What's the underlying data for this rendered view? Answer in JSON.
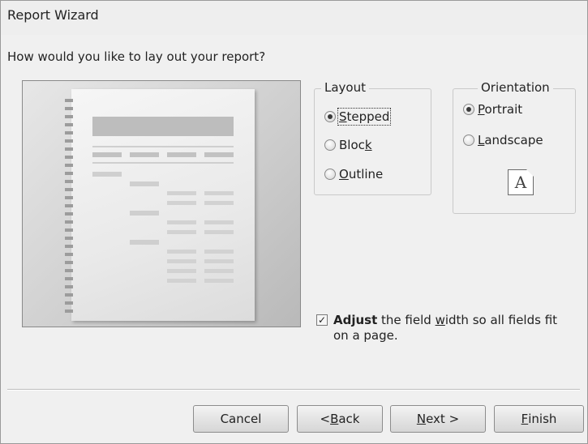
{
  "window": {
    "title": "Report Wizard"
  },
  "question": "How would you like to lay out your report?",
  "layout": {
    "label": "Layout",
    "options": [
      {
        "pre": "",
        "key": "S",
        "post": "tepped",
        "checked": true
      },
      {
        "pre": "Bloc",
        "key": "k",
        "post": "",
        "checked": false
      },
      {
        "pre": "",
        "key": "O",
        "post": "utline",
        "checked": false
      }
    ]
  },
  "orientation": {
    "label": "Orientation",
    "options": [
      {
        "pre": "",
        "key": "P",
        "post": "ortrait",
        "checked": true
      },
      {
        "pre": "",
        "key": "L",
        "post": "andscape",
        "checked": false
      }
    ],
    "icon_letter": "A"
  },
  "adjust": {
    "checked": true,
    "check_glyph": "✓",
    "bold": "Adjust",
    "pre": " the field ",
    "key": "w",
    "post": "idth so all fields fit on a page."
  },
  "buttons": {
    "cancel": "Cancel",
    "back": {
      "pre": "< ",
      "key": "B",
      "post": "ack"
    },
    "next": {
      "pre": "",
      "key": "N",
      "post": "ext >"
    },
    "finish": {
      "pre": "",
      "key": "F",
      "post": "inish"
    }
  }
}
